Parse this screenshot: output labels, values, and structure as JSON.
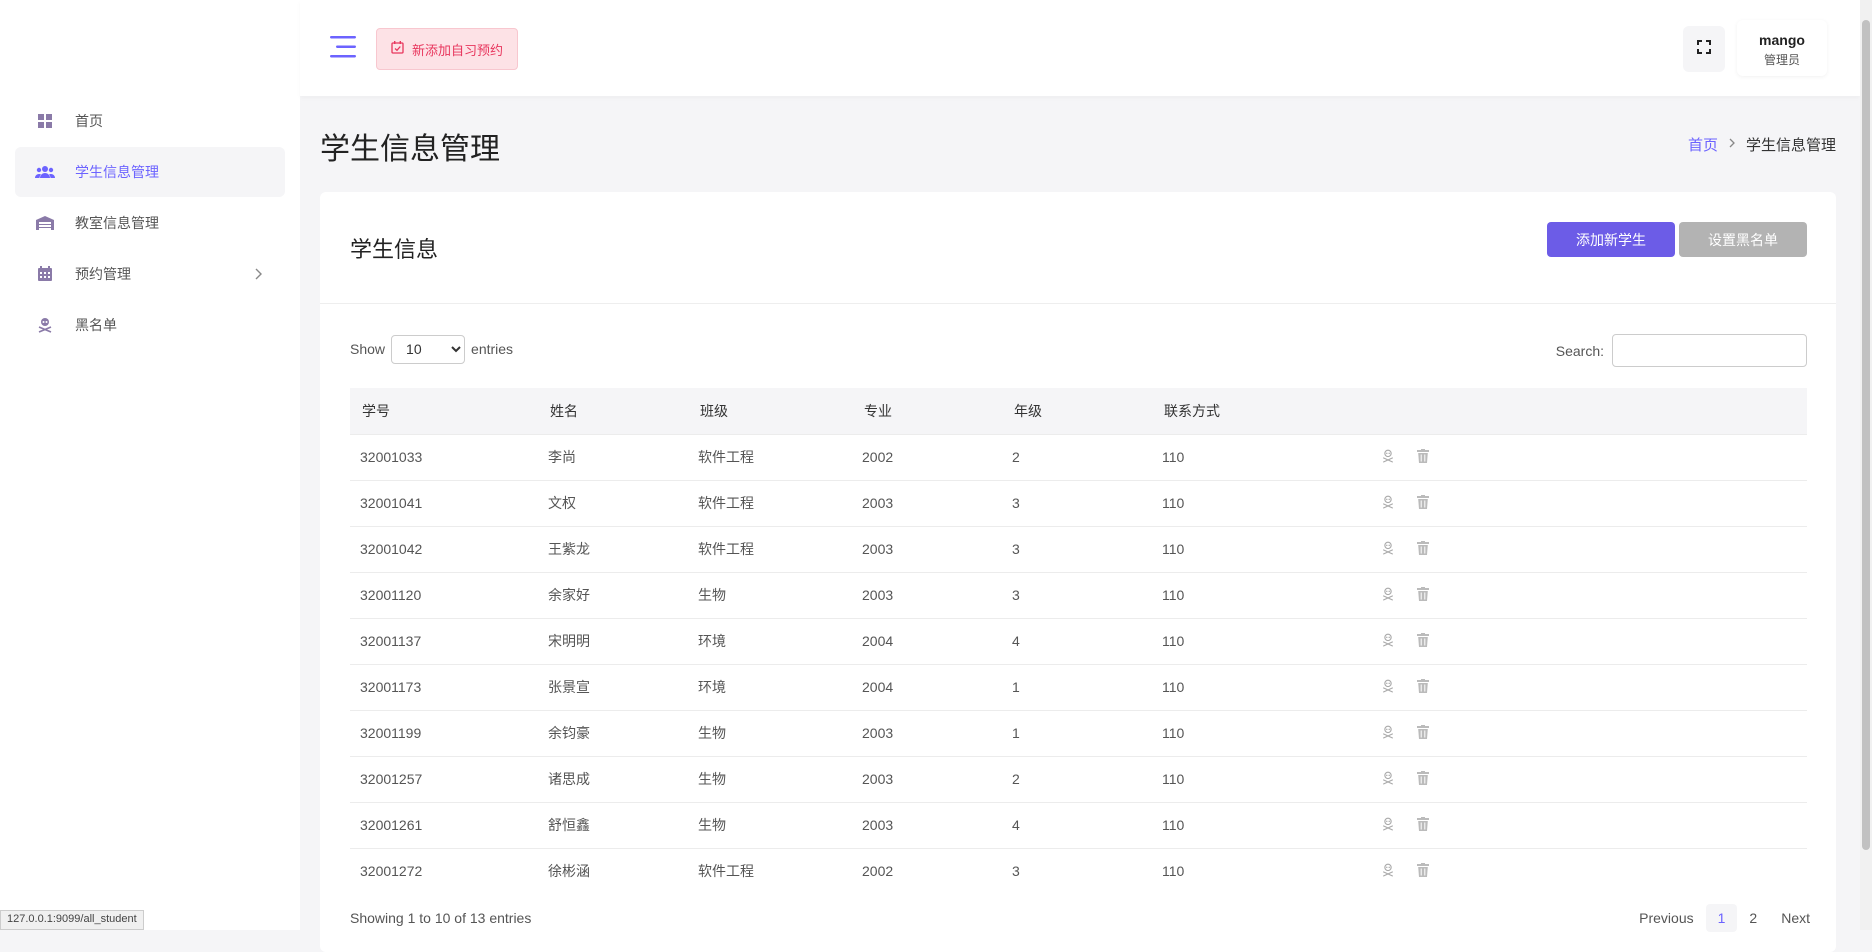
{
  "sidebar": {
    "items": [
      {
        "label": "首页",
        "icon": "dashboard-icon"
      },
      {
        "label": "学生信息管理",
        "icon": "users-icon",
        "active": true
      },
      {
        "label": "教室信息管理",
        "icon": "warehouse-icon"
      },
      {
        "label": "预约管理",
        "icon": "calendar-icon"
      },
      {
        "label": "黑名单",
        "icon": "skull-icon"
      }
    ]
  },
  "header": {
    "new_booking_label": "新添加自习预约",
    "user_name": "mango",
    "user_role": "管理员"
  },
  "page": {
    "title": "学生信息管理",
    "breadcrumb_home": "首页",
    "breadcrumb_current": "学生信息管理"
  },
  "card": {
    "title": "学生信息",
    "add_label": "添加新学生",
    "blacklist_label": "设置黑名单"
  },
  "table_controls": {
    "show_label": "Show",
    "entries_label": "entries",
    "page_size": "10",
    "search_label": "Search:"
  },
  "table": {
    "headers": [
      "学号",
      "姓名",
      "班级",
      "专业",
      "年级",
      "联系方式"
    ],
    "rows": [
      [
        "32001033",
        "李尚",
        "软件工程",
        "2002",
        "2",
        "110"
      ],
      [
        "32001041",
        "文权",
        "软件工程",
        "2003",
        "3",
        "110"
      ],
      [
        "32001042",
        "王紫龙",
        "软件工程",
        "2003",
        "3",
        "110"
      ],
      [
        "32001120",
        "余家好",
        "生物",
        "2003",
        "3",
        "110"
      ],
      [
        "32001137",
        "宋明明",
        "环境",
        "2004",
        "4",
        "110"
      ],
      [
        "32001173",
        "张景宣",
        "环境",
        "2004",
        "1",
        "110"
      ],
      [
        "32001199",
        "余钧豪",
        "生物",
        "2003",
        "1",
        "110"
      ],
      [
        "32001257",
        "诸思成",
        "生物",
        "2003",
        "2",
        "110"
      ],
      [
        "32001261",
        "舒恒鑫",
        "生物",
        "2003",
        "4",
        "110"
      ],
      [
        "32001272",
        "徐彬涵",
        "软件工程",
        "2002",
        "3",
        "110"
      ]
    ]
  },
  "footer": {
    "info": "Showing 1 to 10 of 13 entries",
    "previous": "Previous",
    "pages": [
      "1",
      "2"
    ],
    "next": "Next"
  },
  "status_url": "127.0.0.1:9099/all_student",
  "colors": {
    "accent": "#6c63ff",
    "danger": "#e8365d"
  }
}
